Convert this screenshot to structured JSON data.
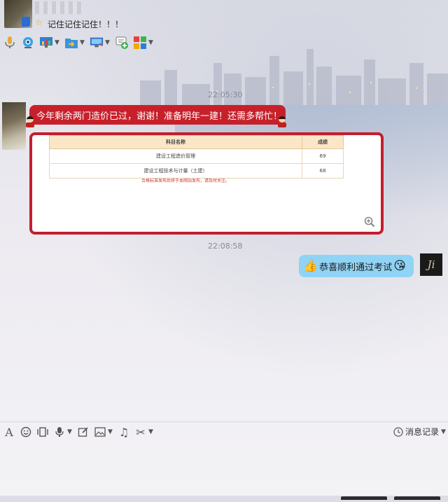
{
  "header": {
    "signature": "记住记住记住！！！",
    "toolbar": [
      {
        "name": "voice-call",
        "icon": "microphone-icon",
        "dropdown": false
      },
      {
        "name": "video-call",
        "icon": "webcam-icon",
        "dropdown": false
      },
      {
        "name": "remote-demo",
        "icon": "screen-chart-icon",
        "dropdown": true
      },
      {
        "name": "send-file",
        "icon": "folder-transfer-icon",
        "dropdown": true
      },
      {
        "name": "remote-desktop",
        "icon": "monitor-icon",
        "dropdown": true
      },
      {
        "name": "create-discussion",
        "icon": "chat-add-icon",
        "dropdown": false
      },
      {
        "name": "apps",
        "icon": "app-grid-icon",
        "dropdown": true
      }
    ]
  },
  "messages": {
    "ts1": "22:05:30",
    "incoming_text": "今年剩余两门造价已过，谢谢！准备明年一建！还需多帮忙！",
    "score_table": {
      "headers": [
        "科目名称",
        "成绩"
      ],
      "rows": [
        [
          "建设工程造价管理",
          "69"
        ],
        [
          "建设工程技术与计量（土建）",
          "68"
        ]
      ],
      "note": "合格标准发布后将于本网站发布，请及时关注。"
    },
    "ts2": "22:08:58",
    "outgoing_text": "恭喜顺利通过考试",
    "outgoing_emoji_left": "👍",
    "outgoing_emoji_right": "😘",
    "my_avatar_text": "Ji"
  },
  "input_toolbar": {
    "history_label": "消息记录"
  },
  "colors": {
    "incoming_bubble": "#c8202a",
    "outgoing_bubble": "#8fd3f5"
  }
}
